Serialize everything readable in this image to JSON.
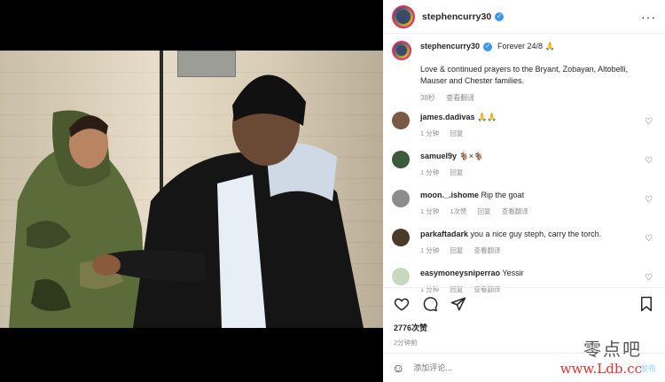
{
  "post": {
    "author": "stephencurry30",
    "caption_title": "Forever 24/8 🙏",
    "caption_text": "Love & continued prayers to the Bryant, Zobayan, Altobelli, Mauser and Chester families.",
    "time": "38秒",
    "see_translation": "查看翻译",
    "likes": "2776次赞",
    "age": "2分钟前",
    "comment_placeholder": "添加评论...",
    "post_label": "发布"
  },
  "comments": [
    {
      "user": "james.dadivas",
      "text": "🙏🙏",
      "time": "1 分钟",
      "reply": "回复",
      "likes": "",
      "translate": ""
    },
    {
      "user": "samuel9y",
      "text": "🐐×🐐",
      "time": "1 分钟",
      "reply": "回复",
      "likes": "",
      "translate": ""
    },
    {
      "user": "moon._.ishome",
      "text": "Rip the goat",
      "time": "1 分钟",
      "reply": "回复",
      "likes": "1次赞",
      "translate": "查看翻译"
    },
    {
      "user": "parkaftadark",
      "text": "you a nice guy steph, carry the torch.",
      "time": "1 分钟",
      "reply": "回复",
      "likes": "",
      "translate": "查看翻译"
    },
    {
      "user": "easymoneysniperrao",
      "text": "Yessir",
      "time": "1 分钟",
      "reply": "回复",
      "likes": "",
      "translate": "查看翻译"
    }
  ],
  "watermark": {
    "line1": "零点吧",
    "line2": "www.Ldb.cc"
  },
  "colors": {
    "accent": "#3897f0",
    "muted": "#8e8e8e",
    "text": "#262626"
  }
}
